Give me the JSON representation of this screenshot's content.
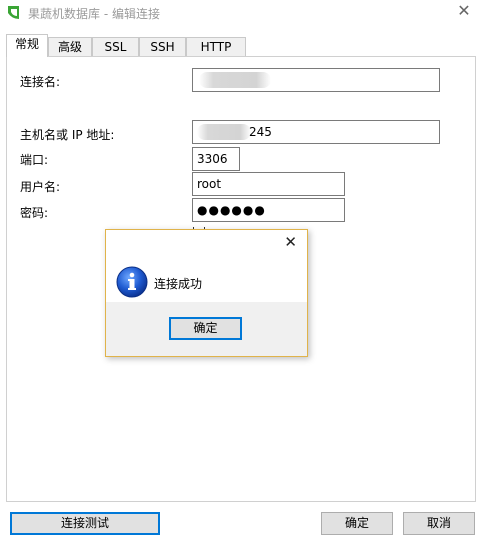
{
  "window": {
    "title": "果蔬机数据库 - 编辑连接",
    "close_glyph": "✕"
  },
  "tabs": [
    {
      "label": "常规",
      "active": true
    },
    {
      "label": "高级",
      "active": false
    },
    {
      "label": "SSL",
      "active": false
    },
    {
      "label": "SSH",
      "active": false
    },
    {
      "label": "HTTP",
      "active": false
    }
  ],
  "form": {
    "connection_name_label": "连接名:",
    "connection_name_value": "",
    "host_label": "主机名或 IP 地址:",
    "host_value_visible": "245",
    "port_label": "端口:",
    "port_value": "3306",
    "username_label": "用户名:",
    "username_value": "root",
    "password_label": "密码:",
    "password_value": "●●●●●●"
  },
  "dialog": {
    "close_glyph": "✕",
    "message": "连接成功",
    "ok_label": "确定"
  },
  "footer": {
    "test_label": "连接测试",
    "ok_label": "确定",
    "cancel_label": "取消"
  },
  "colors": {
    "accent": "#0078d7",
    "dialog_border": "#e0b34a",
    "app_icon_green": "#3aa535"
  }
}
